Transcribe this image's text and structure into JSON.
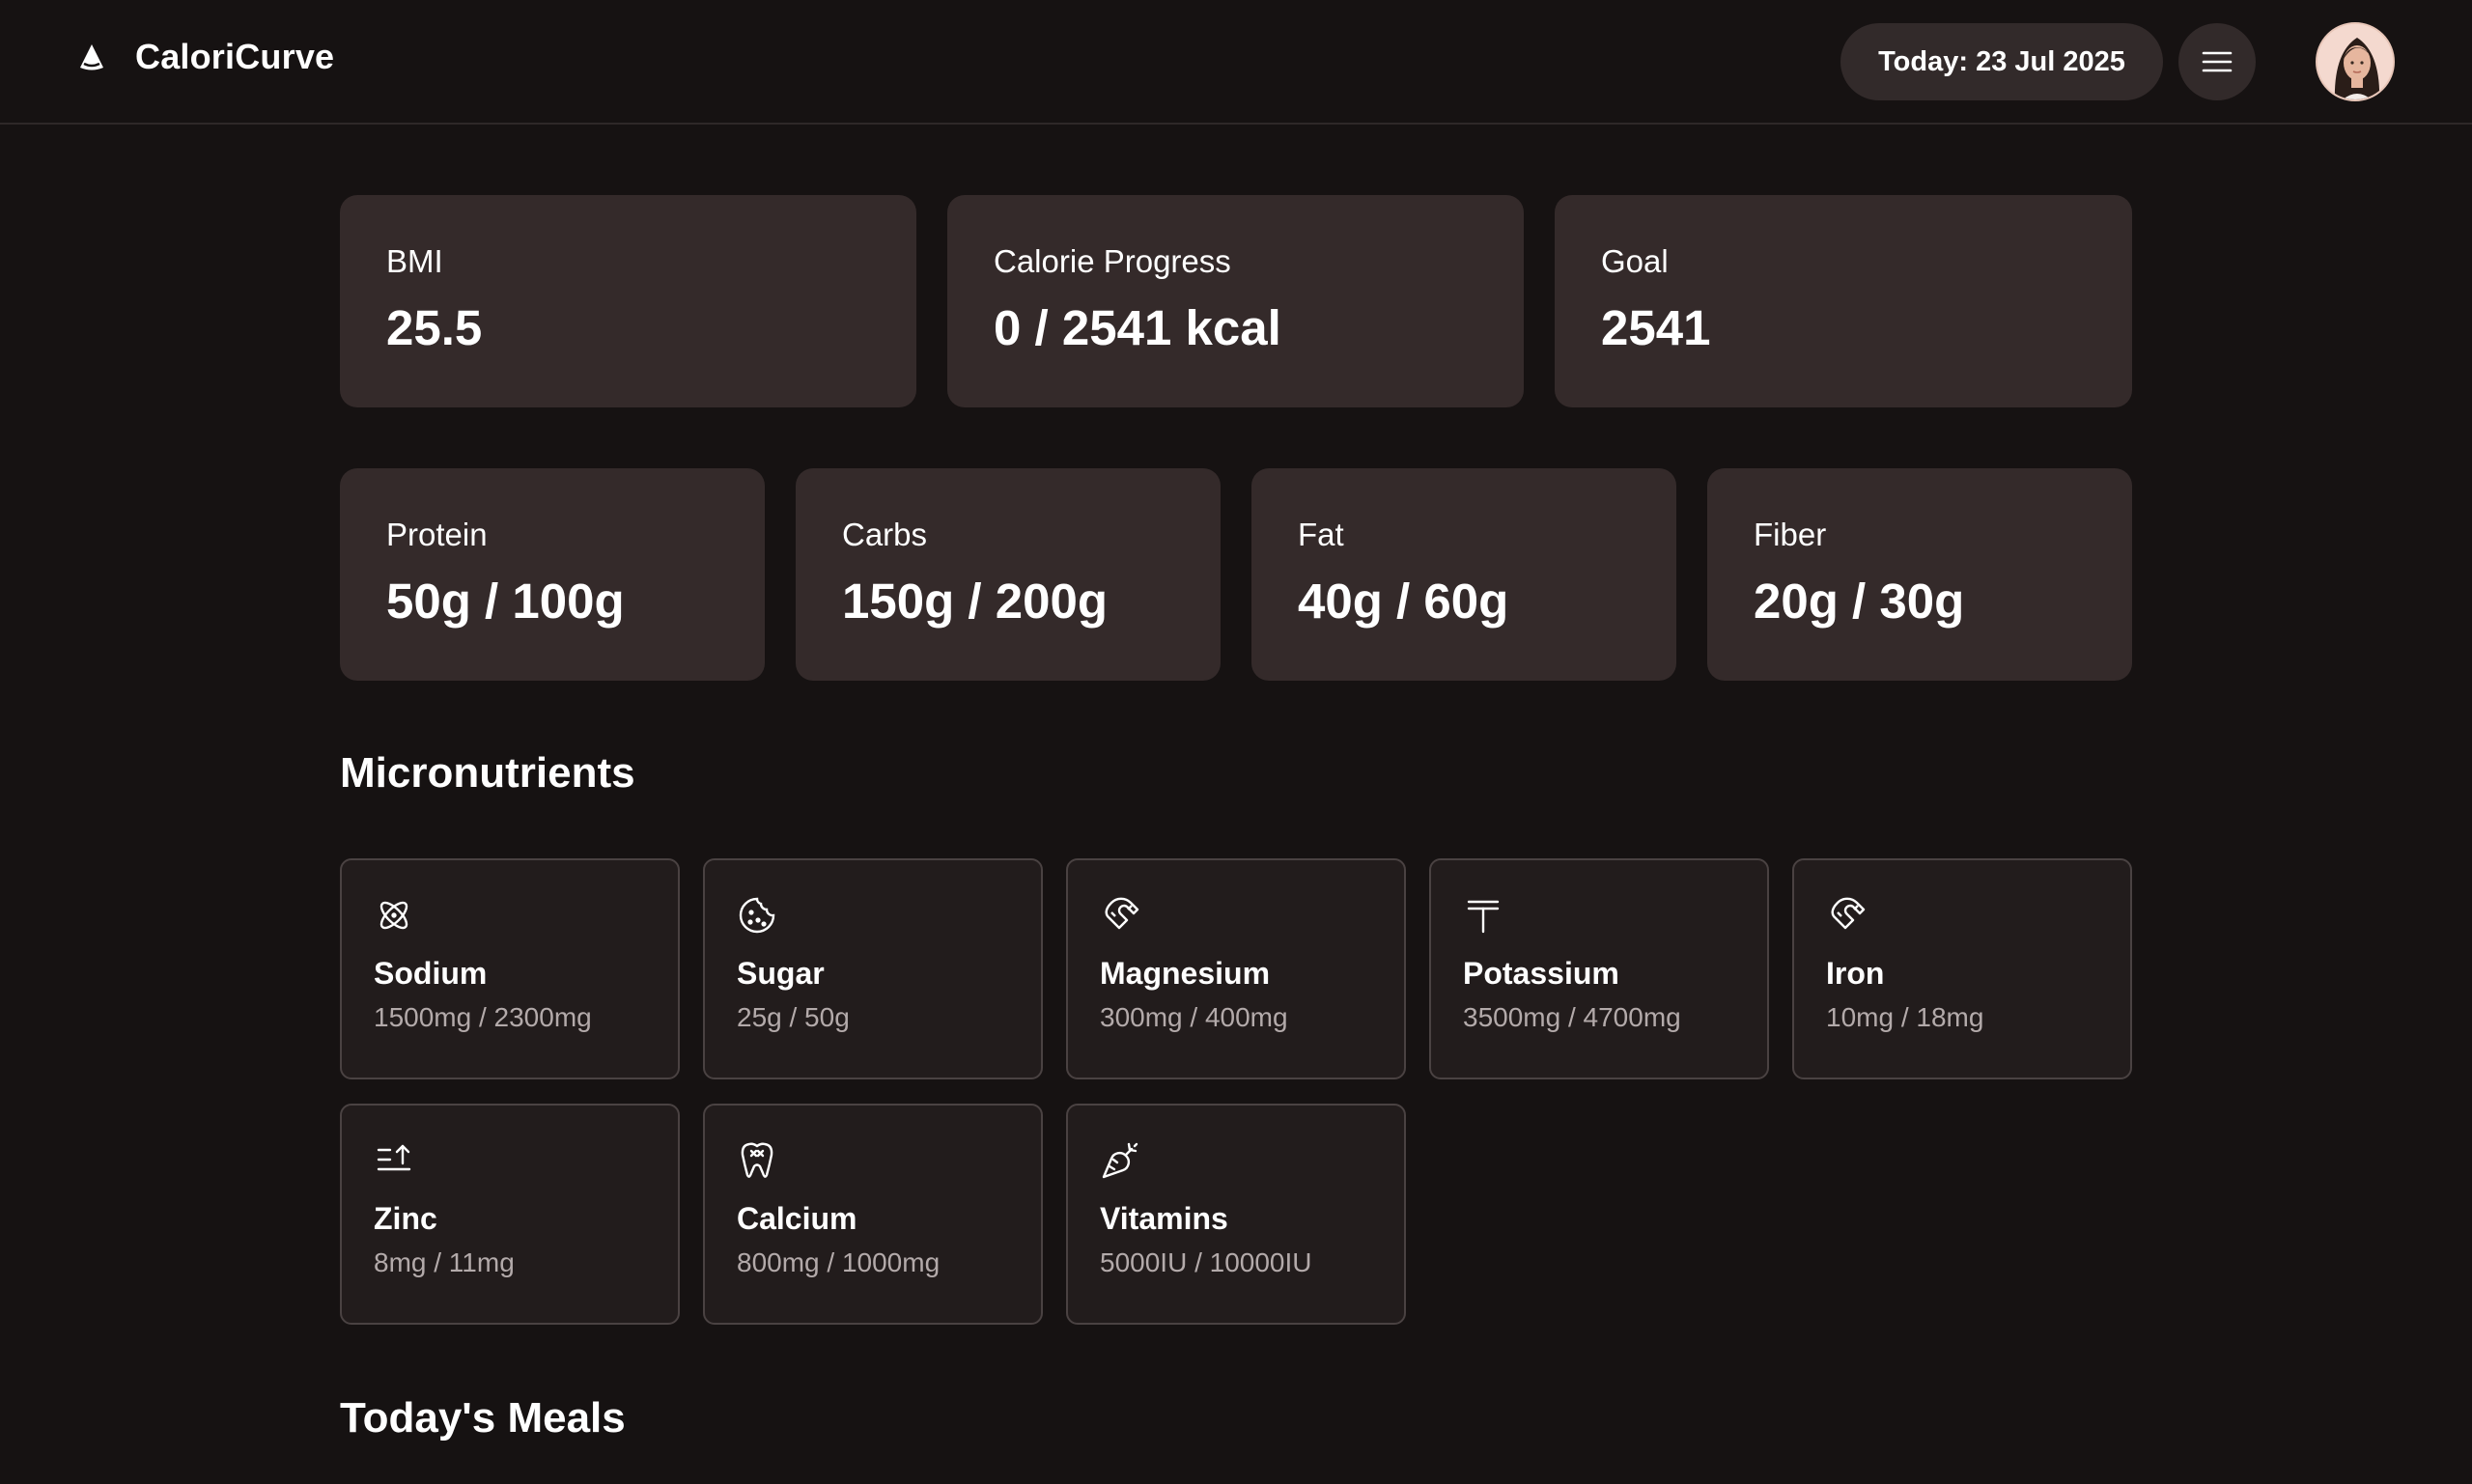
{
  "app": {
    "name": "CaloriCurve"
  },
  "header": {
    "date": "Today: 23 Jul 2025"
  },
  "stats": [
    {
      "label": "BMI",
      "value": "25.5"
    },
    {
      "label": "Calorie Progress",
      "value": "0 / 2541 kcal"
    },
    {
      "label": "Goal",
      "value": "2541"
    }
  ],
  "macros": [
    {
      "label": "Protein",
      "value": "50g / 100g"
    },
    {
      "label": "Carbs",
      "value": "150g / 200g"
    },
    {
      "label": "Fat",
      "value": "40g / 60g"
    },
    {
      "label": "Fiber",
      "value": "20g / 30g"
    }
  ],
  "micronutrients": {
    "title": "Micronutrients",
    "items": [
      {
        "name": "Sodium",
        "value": "1500mg / 2300mg",
        "icon": "atom-icon"
      },
      {
        "name": "Sugar",
        "value": "25g / 50g",
        "icon": "cookie-icon"
      },
      {
        "name": "Magnesium",
        "value": "300mg / 400mg",
        "icon": "magnet-icon"
      },
      {
        "name": "Potassium",
        "value": "3500mg / 4700mg",
        "icon": "potassium-icon"
      },
      {
        "name": "Iron",
        "value": "10mg / 18mg",
        "icon": "magnet-icon"
      },
      {
        "name": "Zinc",
        "value": "8mg / 11mg",
        "icon": "sort-ascending-icon"
      },
      {
        "name": "Calcium",
        "value": "800mg / 1000mg",
        "icon": "tooth-icon"
      },
      {
        "name": "Vitamins",
        "value": "5000IU / 10000IU",
        "icon": "carrot-icon"
      }
    ]
  },
  "meals": {
    "title": "Today's Meals"
  },
  "colors": {
    "background": "#161212",
    "card": "#342a2a",
    "micro_card": "#221c1c",
    "pill": "#322a2a",
    "muted_text": "#b3aaaa"
  }
}
